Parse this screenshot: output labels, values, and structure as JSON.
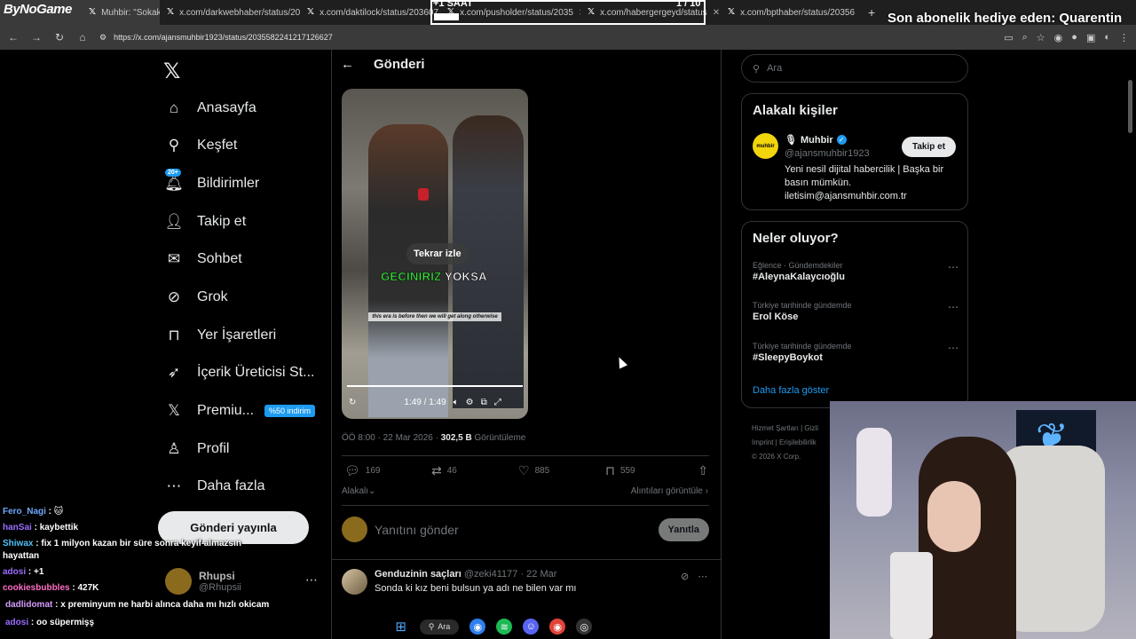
{
  "stream": {
    "logo": "ByNoGame",
    "timer_label": "+1 SAAT",
    "timer_count": "1 / 10",
    "subscription_text": "Son abonelik hediye eden: Quarentin"
  },
  "browser": {
    "tabs": [
      {
        "label": "Muhbir: \"Sokak rö",
        "icon": "x"
      },
      {
        "label": "x.com/darkwebhaber/status/20",
        "icon": "x"
      },
      {
        "label": "x.com/daktilock/status/203607",
        "icon": "x"
      },
      {
        "label": "x.com/pusholder/status/2035",
        "icon": "x"
      },
      {
        "label": "x.com/habergergeyd/status",
        "icon": "x"
      },
      {
        "label": "x.com/bpthaber/status/20356",
        "icon": "x"
      }
    ],
    "url": "https://x.com/ajansmuhbir1923/status/2035582241217126627"
  },
  "sidebar": {
    "items": [
      {
        "label": "Anasayfa",
        "icon": "home-icon"
      },
      {
        "label": "Keşfet",
        "icon": "search-icon"
      },
      {
        "label": "Bildirimler",
        "icon": "bell-icon",
        "badge": "20+"
      },
      {
        "label": "Takip et",
        "icon": "follow-icon"
      },
      {
        "label": "Sohbet",
        "icon": "mail-icon"
      },
      {
        "label": "Grok",
        "icon": "grok-icon"
      },
      {
        "label": "Yer İşaretleri",
        "icon": "bookmark-icon"
      },
      {
        "label": "İçerik Üreticisi St...",
        "icon": "rocket-icon"
      },
      {
        "label": "Premiu...",
        "icon": "x-icon",
        "badge": "%50 indirim"
      },
      {
        "label": "Profil",
        "icon": "person-icon"
      },
      {
        "label": "Daha fazla",
        "icon": "more-icon"
      }
    ],
    "post_button": "Gönderi yayınla",
    "profile_name": "Rhupsi",
    "profile_handle": "@Rhupsii"
  },
  "post": {
    "header": "Gönderi",
    "video": {
      "replay": "Tekrar izle",
      "caption_green": "GEÇINIRIZ",
      "caption_white": "YOKSA",
      "subtitle": "this era is before then we will get along otherwise",
      "time": "1:49 / 1:49"
    },
    "meta_time": "ÖÖ 8:00 · 22 Mar 2026 · ",
    "views": "302,5 B",
    "views_label": " Görüntüleme",
    "replies": "169",
    "reposts": "46",
    "likes": "885",
    "bookmarks": "559",
    "sort": "Alakalı",
    "quotes_link": "Alıntıları görüntüle",
    "reply_placeholder": "Yanıtını gönder",
    "reply_button": "Yanıtla",
    "comment": {
      "name": "Genduzinin saçları",
      "handle": "@zeki41177",
      "date": "22 Mar",
      "text": "Sonda ki kız beni bulsun ya adı ne bilen var mı"
    }
  },
  "right": {
    "search_placeholder": "Ara",
    "related_title": "Alakalı kişiler",
    "related": {
      "avatar_text": "muhbir",
      "name": "Muhbir",
      "handle": "@ajansmuhbir1923",
      "bio": "Yeni nesil dijital habercilik | Başka bir basın mümkün. iletisim@ajansmuhbir.com.tr",
      "follow": "Takip et"
    },
    "trends_title": "Neler oluyor?",
    "trends": [
      {
        "context": "Eğlence · Gündemdekiler",
        "title": "#AleynaKalaycıoğlu"
      },
      {
        "context": "Türkiye tarihinde gündemde",
        "title": "Erol Köse"
      },
      {
        "context": "Türkiye tarihinde gündemde",
        "title": "#SleepyBoykot"
      }
    ],
    "show_more": "Daha fazla göster",
    "footer_1": "Hizmet Şartları | Gizli",
    "footer_2": "Imprint | Erişilebilirlik",
    "footer_3": "© 2026 X Corp."
  },
  "chat": [
    {
      "user": "Fero_Nagi",
      "msg": ""
    },
    {
      "user": "hanSai",
      "msg": "kaybettik"
    },
    {
      "user": "Shiwax",
      "msg": "fix 1 milyon kazan bir süre sonra keyif almazsın hayattan"
    },
    {
      "user": "adosi",
      "msg": "+1"
    },
    {
      "user": "cookiesbubbles",
      "msg": "427K"
    },
    {
      "user": "dadlidomat",
      "msg": "x preminyum ne harbi alınca daha mı hızlı okicam"
    },
    {
      "user": "adosi",
      "msg": "oo süpermişş"
    }
  ],
  "taskbar": {
    "search": "Ara"
  }
}
